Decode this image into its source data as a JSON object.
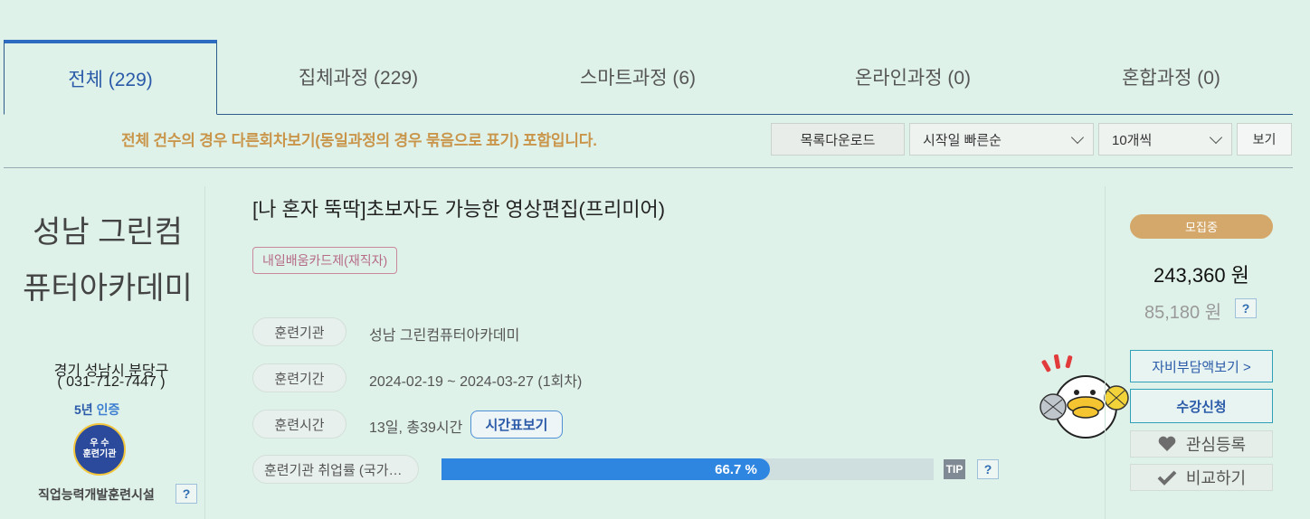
{
  "tabs": [
    {
      "label": "전체 (229)",
      "active": true
    },
    {
      "label": "집체과정 (229)"
    },
    {
      "label": "스마트과정 (6)"
    },
    {
      "label": "온라인과정 (0)"
    },
    {
      "label": "혼합과정 (0)"
    }
  ],
  "toolbar": {
    "notice": "전체 건수의 경우 다른회차보기(동일과정의 경우 묶음으로 표기) 포함입니다.",
    "download_label": "목록다운로드",
    "sort_selected": "시작일 빠른순",
    "page_size_selected": "10개씩",
    "view_label": "보기"
  },
  "org": {
    "name": "성남 그린컴퓨터아카데미",
    "location": "경기 성남시 분당구",
    "phone": "( 031-712-7447 )",
    "cert_years": "5년",
    "cert_suffix": "인증",
    "seal_line1": "우 수",
    "seal_line2": "훈련기관",
    "facility": "직업능력개발훈련시설",
    "help": "?"
  },
  "course": {
    "title": "[나 혼자 뚝딱]초보자도 가능한 영상편집(프리미어)",
    "card_badge": "내일배움카드제(재직자)",
    "institution_label": "훈련기관",
    "institution_value": "성남 그린컴퓨터아카데미",
    "period_label": "훈련기간",
    "period_value": "2024-02-19 ~ 2024-03-27 (1회차)",
    "hours_label": "훈련시간",
    "hours_value": "13일, 총39시간",
    "timetable_button": "시간표보기",
    "employment_label": "훈련기관 취업률 (국가…",
    "employment_rate": 66.7,
    "employment_rate_text": "66.7 %",
    "tip_label": "TIP",
    "help": "?"
  },
  "pricing": {
    "status": "모집중",
    "price": "243,360 원",
    "self_pay": "85,180 원",
    "help": "?",
    "self_pay_button": "자비부담액보기 >",
    "apply_button": "수강신청",
    "wishlist_button": "관심등록",
    "compare_button": "비교하기"
  }
}
